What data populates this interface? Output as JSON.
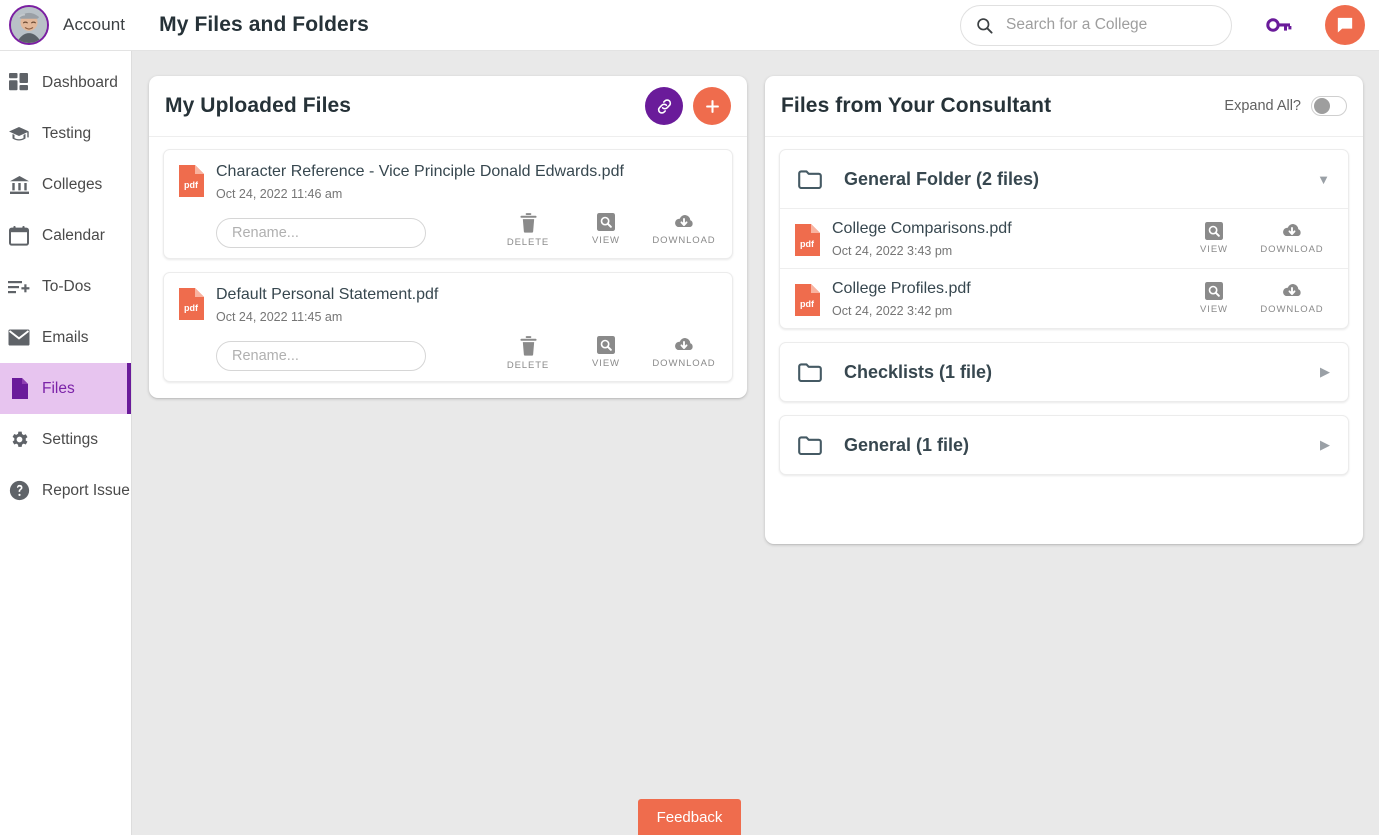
{
  "header": {
    "account_label": "Account",
    "page_title": "My Files and Folders",
    "avatar_icon": "user-avatar-photo",
    "search": {
      "placeholder": "Search for a College",
      "icon": "search-icon"
    },
    "key_icon": "key-icon",
    "chat_icon": "chat-bubble-icon"
  },
  "sidebar": {
    "items": [
      {
        "label": "Dashboard",
        "icon": "dashboard-icon",
        "active": false
      },
      {
        "label": "Testing",
        "icon": "graduation-cap-icon",
        "active": false
      },
      {
        "label": "Colleges",
        "icon": "bank-icon",
        "active": false
      },
      {
        "label": "Calendar",
        "icon": "calendar-icon",
        "active": false
      },
      {
        "label": "To-Dos",
        "icon": "list-add-icon",
        "active": false
      },
      {
        "label": "Emails",
        "icon": "envelope-icon",
        "active": false
      },
      {
        "label": "Files",
        "icon": "file-icon",
        "active": true
      },
      {
        "label": "Settings",
        "icon": "gear-icon",
        "active": false
      },
      {
        "label": "Report Issue",
        "icon": "question-circle-icon",
        "active": false
      }
    ]
  },
  "uploaded_panel": {
    "title": "My Uploaded Files",
    "link_button_icon": "link-icon",
    "add_button_icon": "plus-icon",
    "files": [
      {
        "name": "Character Reference - Vice Principle Donald Edwards.pdf",
        "date": "Oct 24, 2022 11:46 am",
        "type_icon": "pdf-file-icon",
        "rename_placeholder": "Rename...",
        "rename_value": "",
        "actions": [
          {
            "label": "DELETE",
            "icon": "trash-icon"
          },
          {
            "label": "VIEW",
            "icon": "magnify-square-icon"
          },
          {
            "label": "DOWNLOAD",
            "icon": "cloud-download-icon"
          }
        ]
      },
      {
        "name": "Default Personal Statement.pdf",
        "date": "Oct 24, 2022 11:45 am",
        "type_icon": "pdf-file-icon",
        "rename_placeholder": "Rename...",
        "rename_value": "",
        "actions": [
          {
            "label": "DELETE",
            "icon": "trash-icon"
          },
          {
            "label": "VIEW",
            "icon": "magnify-square-icon"
          },
          {
            "label": "DOWNLOAD",
            "icon": "cloud-download-icon"
          }
        ]
      }
    ]
  },
  "consultant_panel": {
    "title": "Files from Your Consultant",
    "expand_all_label": "Expand All?",
    "expand_all_on": false,
    "folders": [
      {
        "name": "General Folder (2 files)",
        "icon": "folder-icon",
        "expanded": true,
        "caret_icon": "caret-down-icon",
        "files": [
          {
            "name": "College Comparisons.pdf",
            "date": "Oct 24, 2022 3:43 pm",
            "type_icon": "pdf-file-icon",
            "actions": [
              {
                "label": "VIEW",
                "icon": "magnify-square-icon"
              },
              {
                "label": "DOWNLOAD",
                "icon": "cloud-download-icon"
              }
            ]
          },
          {
            "name": "College Profiles.pdf",
            "date": "Oct 24, 2022 3:42 pm",
            "type_icon": "pdf-file-icon",
            "actions": [
              {
                "label": "VIEW",
                "icon": "magnify-square-icon"
              },
              {
                "label": "DOWNLOAD",
                "icon": "cloud-download-icon"
              }
            ]
          }
        ]
      },
      {
        "name": "Checklists (1 file)",
        "icon": "folder-icon",
        "expanded": false,
        "caret_icon": "caret-right-icon",
        "files": []
      },
      {
        "name": "General (1 file)",
        "icon": "folder-icon",
        "expanded": false,
        "caret_icon": "caret-right-icon",
        "files": []
      }
    ]
  },
  "feedback": {
    "label": "Feedback"
  },
  "colors": {
    "accent_purple": "#6a1b9a",
    "accent_orange": "#ef6c4d",
    "sidebar_active_bg": "#e7c4ef",
    "sidebar_active_text": "#7b22a8",
    "page_bg": "#e9e9e9",
    "title_text": "#263238",
    "muted_text": "#757575"
  }
}
